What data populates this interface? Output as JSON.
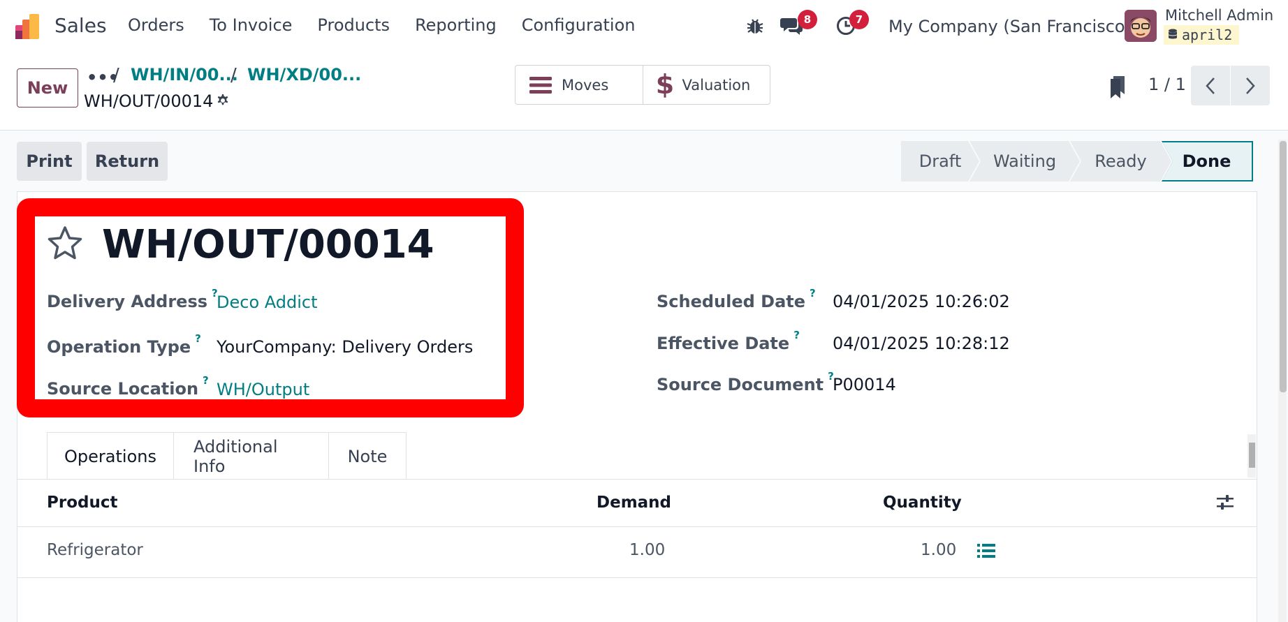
{
  "navbar": {
    "app_name": "Sales",
    "menu": [
      "Orders",
      "To Invoice",
      "Products",
      "Reporting",
      "Configuration"
    ],
    "messages_count": "8",
    "activities_count": "7",
    "company": "My Company (San Francisco)",
    "user_name": "Mitchell Admin",
    "database": "april2"
  },
  "control_panel": {
    "new_label": "New",
    "breadcrumb_more": "•••",
    "breadcrumbs": [
      "WH/IN/00...",
      "WH/XD/00..."
    ],
    "current_record": "WH/OUT/00014",
    "smart_buttons": {
      "moves": "Moves",
      "valuation": "Valuation"
    },
    "pager": "1 / 1"
  },
  "actions": {
    "print": "Print",
    "return": "Return"
  },
  "statusbar": [
    "Draft",
    "Waiting",
    "Ready",
    "Done"
  ],
  "status_active": "Done",
  "record": {
    "title": "WH/OUT/00014",
    "left_fields": [
      {
        "label": "Delivery Address",
        "value": "Deco Addict"
      },
      {
        "label": "Operation Type",
        "value": "YourCompany: Delivery Orders"
      },
      {
        "label": "Source Location",
        "value": "WH/Output"
      }
    ],
    "right_fields": [
      {
        "label": "Scheduled Date",
        "value": "04/01/2025 10:26:02"
      },
      {
        "label": "Effective Date",
        "value": "04/01/2025 10:28:12"
      },
      {
        "label": "Source Document",
        "value": "P00014"
      }
    ],
    "help_mark": "?"
  },
  "tabs": [
    "Operations",
    "Additional Info",
    "Note"
  ],
  "operations_table": {
    "columns": [
      "Product",
      "Demand",
      "Quantity"
    ],
    "rows": [
      {
        "product": "Refrigerator",
        "demand": "1.00",
        "quantity": "1.00"
      }
    ]
  },
  "colors": {
    "brand": "#7b3f5a",
    "link": "#017e84",
    "highlight": "#ff0000",
    "badge": "#d21f3c"
  }
}
